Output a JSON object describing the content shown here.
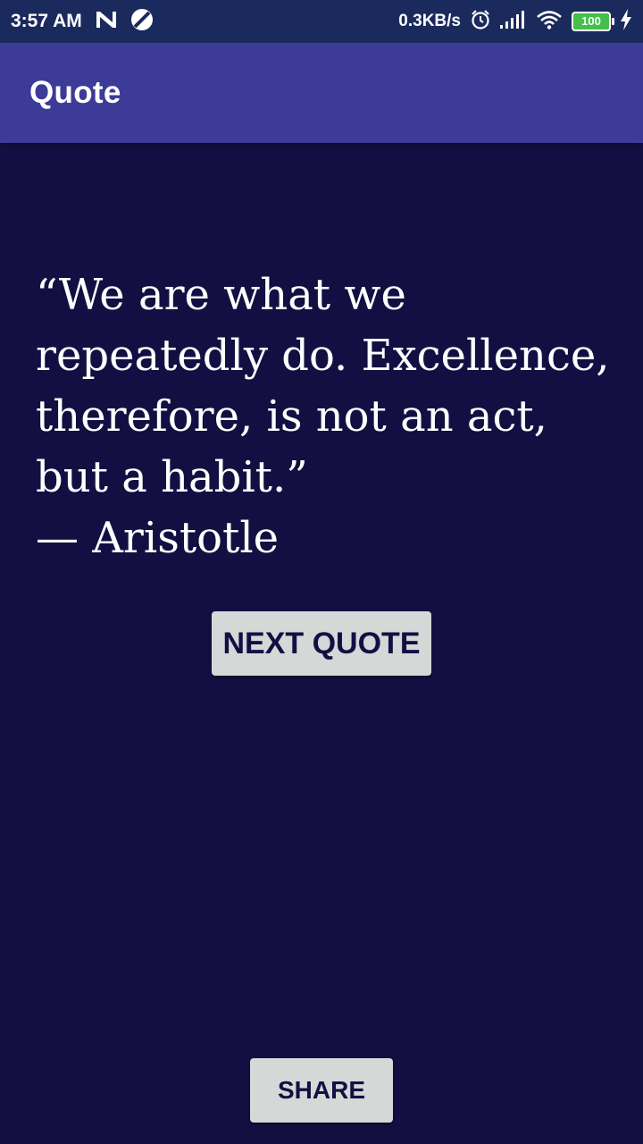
{
  "status_bar": {
    "time": "3:57 AM",
    "network_speed": "0.3KB/s",
    "battery_level": "100",
    "icons": [
      "n-notification-icon",
      "blocked-app-icon",
      "alarm-icon",
      "signal-icon",
      "wifi-icon",
      "battery-icon",
      "charging-icon"
    ]
  },
  "app_bar": {
    "title": "Quote"
  },
  "quote": {
    "text": "“We are what we repeatedly do. Excellence, therefore, is not an act, but a habit.”",
    "author": "— Aristotle"
  },
  "buttons": {
    "next_label": "Next Quote",
    "share_label": "Share"
  },
  "colors": {
    "background": "#140f42",
    "app_bar": "#3c3b98",
    "status_bar": "#1b2a5c",
    "button_bg": "#d6d7d7",
    "button_text": "#140f42",
    "battery": "#43c04a"
  }
}
